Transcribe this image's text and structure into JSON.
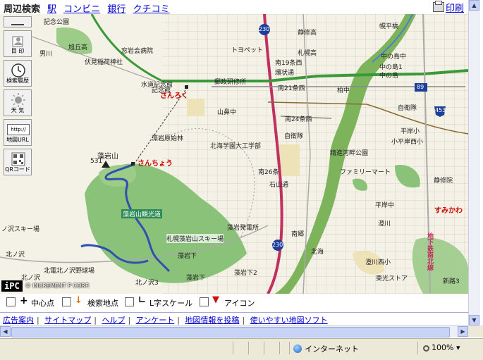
{
  "header": {
    "title": "周辺検索",
    "nav": [
      "駅",
      "コンビニ",
      "銀行",
      "クチコミ"
    ],
    "print_label": "印刷"
  },
  "toolbar": {
    "minimize_icon": "minimize-icon",
    "buttons": [
      {
        "label": "目 印",
        "icon": "landmark-icon"
      },
      {
        "label": "検索履歴",
        "icon": "clock-icon"
      },
      {
        "label": "天 気",
        "icon": "sun-icon"
      },
      {
        "label": "地図URL",
        "icon": "url-icon",
        "icon_text": "http://"
      },
      {
        "label": "QRコード",
        "icon": "qr-icon"
      }
    ]
  },
  "map": {
    "labels": {
      "l01": "記念公園",
      "l02": "旭丘高",
      "l03": "窓岩会病院",
      "l04": "男川",
      "l05": "伏見稲荷神社",
      "l06": "水道記念館",
      "l07": "さんろく",
      "l08": "藻岩原始林",
      "l09": "藻岩山",
      "l10": "531",
      "l11": "さんちょう",
      "l12": "藻岩山観光道",
      "l13": "北海学園大工学部",
      "l14": "藻岩発電所",
      "l15": "札幌藻岩山スキー場",
      "l16": "藻岩下",
      "l17": "藻岩下",
      "l18": "藻岩下2",
      "l19": "北ノ沢",
      "l20": "北ノ沢3",
      "l21": "北電北ノ沢野球場",
      "l22": "ノ沢スキー場",
      "l23": "北ノ沢",
      "l24": "トヨペット",
      "l25": "静修高",
      "l26": "札幌高",
      "l27": "環状通",
      "l28": "南19条西",
      "l29": "郵政研修所",
      "l30": "南21条西",
      "l31": "山鼻中",
      "l32": "南24条西",
      "l33": "自衛隊",
      "l34": "南26条",
      "l35": "石山通",
      "l36": "柏中",
      "l37": "幌平橋",
      "l38": "中の島中",
      "l39": "中の島1",
      "l40": "中の島",
      "l41": "自衛隊",
      "l42": "平岸小",
      "l43": "小平岸西小",
      "l44": "精進河畔公園",
      "l45": "ファミリーマート",
      "l46": "静修院",
      "l47": "平岸中",
      "l48": "すみかわ",
      "l49": "澄川",
      "l50": "澄川西小",
      "l51": "東光ストア",
      "l52": "地下鉄南北線",
      "l53": "新路3",
      "l54": "南郷",
      "l55": "北海",
      "l56": "230",
      "l57": "230",
      "l58": "89",
      "l59": "453",
      "l60": "記念館"
    },
    "copyright": "© INCREMENT P CORP.",
    "logo_text": "iPC"
  },
  "legend": {
    "center": "中心点",
    "search": "検索地点",
    "scale": "L字スケール",
    "icon": "アイコン"
  },
  "links": [
    "広告案内",
    "サイトマップ",
    "ヘルプ",
    "アンケート",
    "地図情報を投稿",
    "使いやすい地図ソフト"
  ],
  "status": {
    "zone": "インターネット",
    "zoom": "100%"
  },
  "colors": {
    "river": "#7db35a",
    "park": "#8bc27a",
    "road_main": "#c03060",
    "road_green": "#3a9a3a",
    "trail": "#3050b0"
  }
}
